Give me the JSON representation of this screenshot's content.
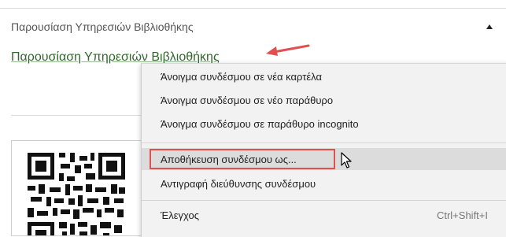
{
  "accordion": {
    "title": "Παρουσίαση Υπηρεσιών Βιβλιοθήκης"
  },
  "link": {
    "text": "Παρουσίαση Υπηρεσιών Βιβλιοθήκης"
  },
  "context_menu": {
    "items": [
      {
        "label": "Άνοιγμα συνδέσμου σε νέα καρτέλα"
      },
      {
        "label": "Άνοιγμα συνδέσμου σε νέο παράθυρο"
      },
      {
        "label": "Άνοιγμα συνδέσμου σε παράθυρο incognito"
      },
      {
        "label": "Αποθήκευση συνδέσμου ως..."
      },
      {
        "label": "Αντιγραφή διεύθυνσης συνδέσμου"
      },
      {
        "label": "Έλεγχος",
        "shortcut": "Ctrl+Shift+I"
      }
    ]
  },
  "colors": {
    "link": "#2f6a2a",
    "annotation_red": "#e05050",
    "menu_bg": "#f2f2f2",
    "menu_hover": "#dcdcdc"
  },
  "icons": [
    "caret-up-icon",
    "red-arrow-icon",
    "qr-code",
    "mouse-pointer-icon"
  ]
}
